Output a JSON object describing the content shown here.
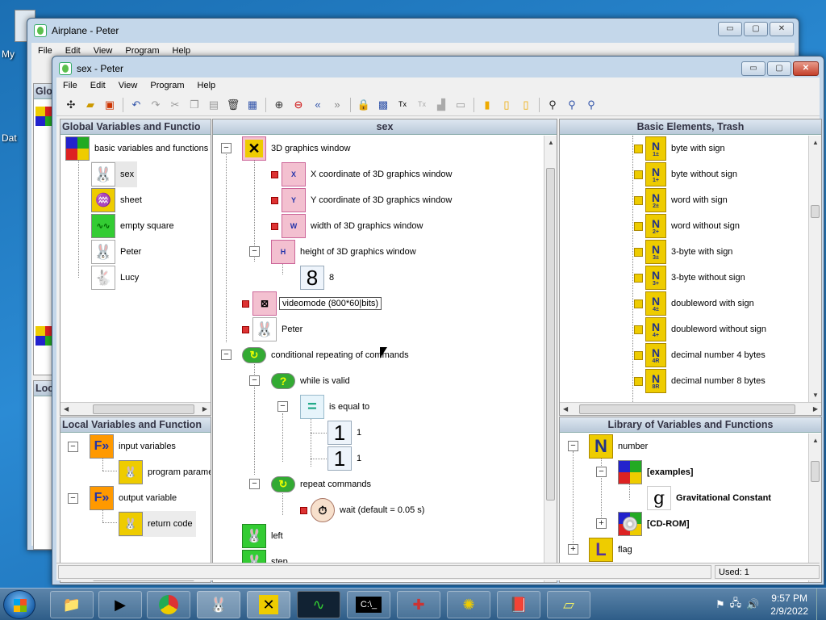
{
  "desktop": {
    "label1": "My",
    "label2": "Dat"
  },
  "back_window": {
    "title": "Airplane - Peter",
    "menu": [
      "File",
      "Edit",
      "View",
      "Program",
      "Help"
    ],
    "partial_labels": [
      "Glo",
      "Loc"
    ]
  },
  "front_window": {
    "title": "sex - Peter",
    "menu": [
      "File",
      "Edit",
      "View",
      "Program",
      "Help"
    ],
    "caption_buttons": {
      "minimize": "▭",
      "maximize": "▢",
      "close": "✕"
    }
  },
  "toolbar_icons": [
    "exec-icon",
    "open-icon",
    "save-icon",
    "undo-icon",
    "redo-icon",
    "cut-icon",
    "copy-icon",
    "paste-icon",
    "delete-icon",
    "select-icon",
    "zoom-in-icon",
    "zoom-out-icon",
    "back-icon",
    "forward-icon",
    "lock-icon",
    "grid-icon",
    "text-icon",
    "text-disabled-icon",
    "paint-icon",
    "picture-icon",
    "lock-yellow-icon",
    "lock-open-icon",
    "lock-open2-icon",
    "find-icon",
    "find-next-icon",
    "find-prev-icon"
  ],
  "global_panel": {
    "header": "Global Variables and Functio",
    "items": [
      {
        "label": "basic variables and functions",
        "icon": "color-squares-icon"
      },
      {
        "label": "sex",
        "icon": "rabbit-icon"
      },
      {
        "label": "sheet",
        "icon": "sheet-icon"
      },
      {
        "label": "empty square",
        "icon": "empty-square-icon"
      },
      {
        "label": "Peter",
        "icon": "rabbit-icon"
      },
      {
        "label": "Lucy",
        "icon": "rabbit-girl-icon"
      }
    ]
  },
  "local_panel": {
    "header": "Local Variables and Function",
    "items": [
      {
        "label": "input variables",
        "icon": "input-f-icon"
      },
      {
        "label": "program parame",
        "icon": "program-param-icon"
      },
      {
        "label": "output variable",
        "icon": "output-f-icon"
      },
      {
        "label": "return code",
        "icon": "return-code-icon"
      }
    ]
  },
  "program_panel": {
    "header": "sex",
    "items": [
      {
        "label": "3D graphics window",
        "icon": "3d-window-icon"
      },
      {
        "label": "X coordinate of 3D graphics window",
        "icon": "x-coordinate-icon",
        "sub": "X"
      },
      {
        "label": "Y coordinate of 3D graphics window",
        "icon": "y-coordinate-icon",
        "sub": "Y"
      },
      {
        "label": "width of 3D graphics window",
        "icon": "width-icon",
        "sub": "W"
      },
      {
        "label": "height of 3D graphics window",
        "icon": "height-icon",
        "sub": "H"
      },
      {
        "label": "8",
        "icon": "digit-8-icon",
        "glyph": "8"
      },
      {
        "label": "videomode (800*60|bits)",
        "icon": "videomode-icon"
      },
      {
        "label": "Peter",
        "icon": "rabbit-icon"
      },
      {
        "label": "conditional repeating of commands",
        "icon": "loop-icon"
      },
      {
        "label": "while is valid",
        "icon": "question-icon"
      },
      {
        "label": "is equal to",
        "icon": "equals-icon",
        "glyph": "="
      },
      {
        "label": "1",
        "icon": "digit-1-icon",
        "glyph": "1"
      },
      {
        "label": "1",
        "icon": "digit-1-icon",
        "glyph": "1"
      },
      {
        "label": "repeat commands",
        "icon": "loop-icon"
      },
      {
        "label": "wait (default = 0.05 s)",
        "icon": "stopwatch-icon"
      },
      {
        "label": "left",
        "icon": "rabbit-left-icon"
      },
      {
        "label": "step",
        "icon": "rabbit-step-icon"
      }
    ]
  },
  "basic_panel": {
    "header": "Basic Elements, Trash",
    "items": [
      {
        "label": "byte with sign",
        "sub": "1±"
      },
      {
        "label": "byte without sign",
        "sub": "1+"
      },
      {
        "label": "word with sign",
        "sub": "2±"
      },
      {
        "label": "word without sign",
        "sub": "2+"
      },
      {
        "label": "3-byte with sign",
        "sub": "3±"
      },
      {
        "label": "3-byte without sign",
        "sub": "3+"
      },
      {
        "label": "doubleword with sign",
        "sub": "4±"
      },
      {
        "label": "doubleword without sign",
        "sub": "4+"
      },
      {
        "label": "decimal number 4 bytes",
        "sub": "4R"
      },
      {
        "label": "decimal number 8 bytes",
        "sub": "8R"
      }
    ]
  },
  "library_panel": {
    "header": "Library of Variables and Functions",
    "items": [
      {
        "label": "number",
        "icon": "n-letter-icon",
        "glyph": "N"
      },
      {
        "label": "[examples]",
        "icon": "color-squares-icon"
      },
      {
        "label": "Gravitational Constant",
        "icon": "g-letter-icon",
        "glyph": "g"
      },
      {
        "label": "[CD-ROM]",
        "icon": "cd-rom-icon"
      },
      {
        "label": "flag",
        "icon": "l-letter-icon",
        "glyph": "L"
      }
    ]
  },
  "status": {
    "used": "Used: 1"
  },
  "taskbar": {
    "apps": [
      "explorer-icon",
      "media-player-icon",
      "chrome-icon",
      "peter-rabbit-icon",
      "x-cross-icon",
      "oscilloscope-icon",
      "cmd-icon",
      "puzzle-icon",
      "film-icon",
      "help-book-icon",
      "sticky-notes-icon"
    ],
    "time": "9:57 PM",
    "date": "2/9/2022"
  },
  "colors": {
    "accent": "#2e5d88",
    "panel_header": "#c9d6e3",
    "selection": "#ececec"
  }
}
